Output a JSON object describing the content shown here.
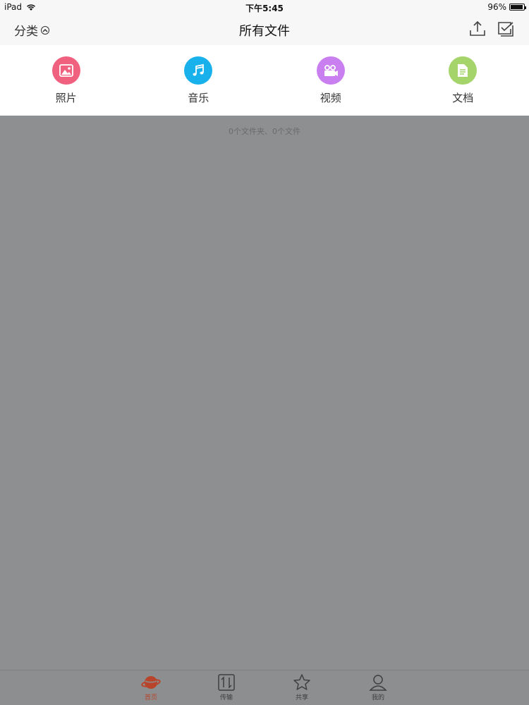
{
  "status_bar": {
    "device": "iPad",
    "time": "下午5:45",
    "battery": "96%",
    "battery_level": 0.96
  },
  "nav": {
    "category_label": "分类",
    "title": "所有文件",
    "icons": [
      "upload-icon",
      "multi-select-icon"
    ]
  },
  "categories": [
    {
      "label": "照片",
      "icon": "photo-icon",
      "color": "#f0607f"
    },
    {
      "label": "音乐",
      "icon": "music-icon",
      "color": "#19b1ec"
    },
    {
      "label": "视频",
      "icon": "video-icon",
      "color": "#c97ff0"
    },
    {
      "label": "文档",
      "icon": "document-icon",
      "color": "#a4d46a"
    }
  ],
  "content": {
    "summary": "0个文件夹、0个文件"
  },
  "tabs": [
    {
      "label": "首页",
      "icon": "planet-icon",
      "active": true
    },
    {
      "label": "传输",
      "icon": "transfer-icon",
      "active": false
    },
    {
      "label": "共享",
      "icon": "star-icon",
      "active": false
    },
    {
      "label": "我的",
      "icon": "person-icon",
      "active": false
    }
  ],
  "colors": {
    "overlay_gray": "#8e8f90",
    "active_tab": "#b8452b"
  }
}
